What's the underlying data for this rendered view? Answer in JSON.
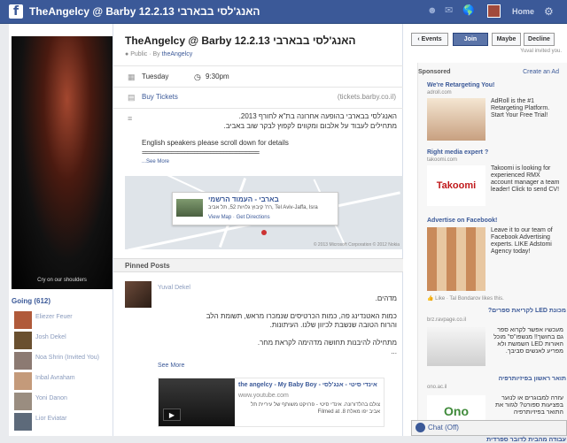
{
  "topbar": {
    "logo": "f",
    "title": "TheAngelcy @ Barby 12.2.13 האנג'לסי בבארבי",
    "icons": [
      "friend-requests-icon",
      "messages-icon",
      "notifications-icon"
    ],
    "home_label": "Home",
    "settings_icon": "gear-icon"
  },
  "left": {
    "poster_caption": "Cry on our shoulders",
    "going_header": "Going (612)",
    "going_people": [
      {
        "name": "Eliezer Feuer"
      },
      {
        "name": "Josh Dekel"
      },
      {
        "name": "Noa Shrin (Invited You)"
      },
      {
        "name": "Inbal Avraham"
      },
      {
        "name": "Yoni Danon"
      },
      {
        "name": "Lior Eviatar"
      }
    ]
  },
  "event": {
    "title": "TheAngelcy @ Barby 12.2.13 האנג'לסי בבארבי",
    "privacy_label": "Public · By",
    "host": "theAngelcy",
    "day": "Tuesday",
    "time": "9:30pm",
    "tickets_label": "Buy Tickets",
    "tickets_domain": "(tickets.barby.co.il)",
    "desc_line1": "האנג'לסי בבארבי בהופעה אחרונה בת\"א לחורף 2013.",
    "desc_line2": "מתחילים לעבוד על אלבום ומקווים לקפוץ לבקר שוב באביב.",
    "desc_line3": "English speakers please scroll down for details",
    "desc_line4": "====================================",
    "see_more": "...See More",
    "map": {
      "venue": "בארבי - העמוד הרשמי",
      "address": "רח' קיבוץ גלויות 52, תל אביב, Tel Aviv-Jaffa, Isra",
      "links": "View Map · Get Directions",
      "copyright": "© 2013 Microsoft Corporation  © 2012 Nokia"
    }
  },
  "pinned": {
    "header": "Pinned Posts",
    "author": "Yuval Dekel",
    "body_line1": "מדהים.",
    "body_line2": "כמות האטנדינג פה, כמות הכרטיסים שנמכרו מראש, תשומת הלב",
    "body_line3": "והרוח הטובה שנשבת לכיוון שלנו. העיתונות.",
    "body_line4": "מתחילה להיבנות תחושה מדהימה לקראת מחר.",
    "body_line5": "...",
    "see_more": "See More",
    "attachment": {
      "title": "the angelcy - My Baby Boy - אינדי סיטי - אנג'לסי",
      "url": "www.youtube.com",
      "desc": "צולם בהלדורונה. אינדי סיטי - פרויקט משותף של עיריית תל אביב יפו מאלת  Filmed at .8"
    }
  },
  "sidebar": {
    "events_button": "‹ Events",
    "join_button": "Join",
    "maybe_button": "Maybe",
    "decline_button": "Decline",
    "invited_text": "Yuval invited you.",
    "sponsored": "Sponsored",
    "create_ad": "Create an Ad",
    "ads": [
      {
        "title": "We're Retargeting You!",
        "url": "adroll.com",
        "text": "AdRoll is the #1 Retargeting Platform. Start Your Free Trial!"
      },
      {
        "title": "Right media expert ?",
        "url": "takoomi.com",
        "text": "Takoomi is looking for experienced RMX account manager a team leader! Click to send CV!",
        "logo": "Takoomi"
      },
      {
        "title": "Advertise on Facebook!",
        "url": "",
        "text": "Leave it to our team of Facebook Advertising experts. LIKE Adstomi Agency today!"
      },
      {
        "title": "מכונת LED לקריאת ספרים?",
        "url": "brz.ravpage.co.il",
        "text": "מעכשיו אפשר לקרוא ספר גם בחושך!! מנשפו\"ס\" מוכל האורות LED השמשת ולא מפריע לאנשים סביבך."
      },
      {
        "title": "תואר ראשון בפיזיותרפיה",
        "url": "ono.ac.il",
        "text": "עזרה למבוגרים או לנוער בפציעות ספורט? לגזור את התואר בפיזיותרפיה",
        "logo": "Ono"
      },
      {
        "title": "עבודה מהבית לדובר ספרדית",
        "url": "",
        "text": ""
      }
    ],
    "like_line": "Like · Tal Bondarov likes this."
  },
  "chat": {
    "label": "Chat (Off)"
  }
}
